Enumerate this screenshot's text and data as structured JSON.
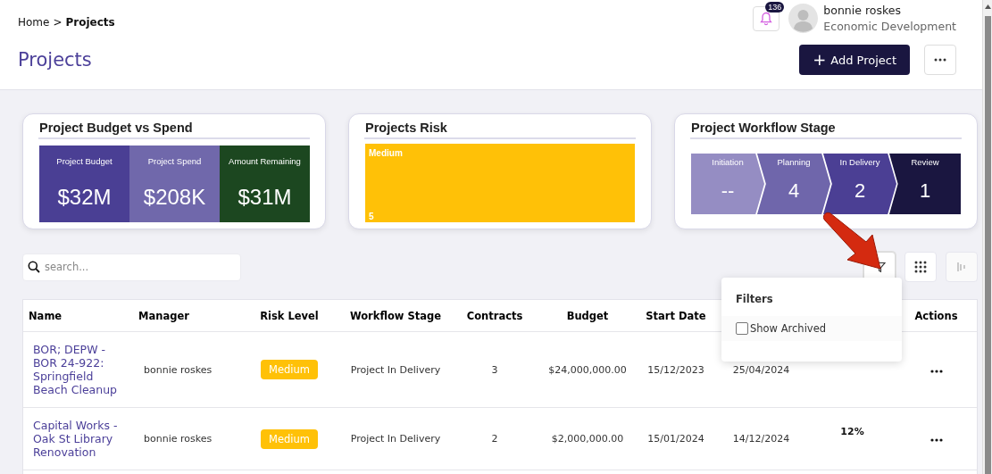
{
  "breadcrumb": {
    "items": [
      {
        "label": "Home",
        "separator": ">"
      },
      {
        "label": "Projects"
      }
    ]
  },
  "notifications": {
    "count": "136"
  },
  "user": {
    "name": "bonnie roskes",
    "department": "Economic Development"
  },
  "page_title": "Projects",
  "header_buttons": [
    {
      "kind": "primary",
      "label": "Add Project",
      "icon": "+"
    },
    {
      "kind": "more"
    }
  ],
  "cards": [
    {
      "kind": "kpi",
      "title": "Project Budget vs Spend",
      "tiles": [
        {
          "label": "Project Budget",
          "value": "$32M",
          "color": "#4a3f94"
        },
        {
          "label": "Project Spend",
          "value": "$208K",
          "color": "#7068ab"
        },
        {
          "label": "Amount Remaining",
          "value": "$31M",
          "color": "#1c4720"
        }
      ]
    },
    {
      "kind": "treemap",
      "title": "Projects Risk",
      "tiles": [
        {
          "label": "Medium",
          "value": "5",
          "color": "#ffc107"
        }
      ]
    },
    {
      "kind": "stages",
      "title": "Project Workflow Stage",
      "tiles": [
        {
          "label": "Initiation",
          "value": "--",
          "color": "#958dc3"
        },
        {
          "label": "Planning",
          "value": "4",
          "color": "#6f66ab"
        },
        {
          "label": "In Delivery",
          "value": "2",
          "color": "#4b3f94"
        },
        {
          "label": "Review",
          "value": "1",
          "color": "#1a1640"
        }
      ]
    }
  ],
  "search": {
    "placeholder": "search..."
  },
  "toolbar_buttons": [
    {
      "kind": "filter",
      "selected": true
    },
    {
      "kind": "grid",
      "selected": false
    },
    {
      "kind": "columns",
      "selected": false
    }
  ],
  "filter_popup": {
    "title": "Filters",
    "options": [
      {
        "label": "Show Archived",
        "checked": false
      }
    ]
  },
  "table": {
    "columns": [
      "Name",
      "Manager",
      "Risk Level",
      "Workflow Stage",
      "Contracts",
      "Budget",
      "Start Date",
      "Actions"
    ],
    "rows": [
      {
        "name": "BOR; DEPW - BOR 24-922: Springfield Beach Cleanup",
        "manager": "bonnie roskes",
        "risk": "Medium",
        "stage": "Project In Delivery",
        "contracts": "3",
        "budget": "$24,000,000.00",
        "start_date": "15/12/2023",
        "end_date": "25/04/2024"
      },
      {
        "name": "Capital Works - Oak St Library Renovation",
        "manager": "bonnie roskes",
        "risk": "Medium",
        "stage": "Project In Delivery",
        "contracts": "2",
        "budget": "$2,000,000.00",
        "start_date": "15/01/2024",
        "end_date": "14/12/2024",
        "progress": "12%"
      }
    ]
  }
}
